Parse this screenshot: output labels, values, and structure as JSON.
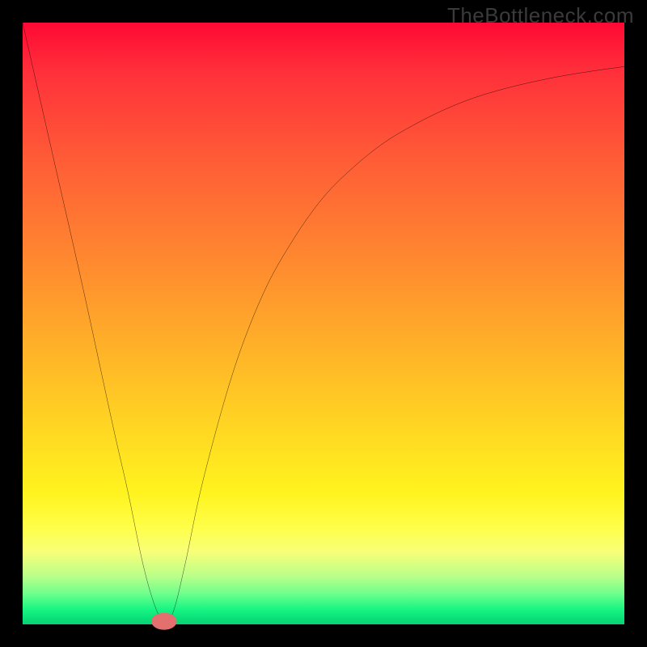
{
  "watermark": "TheBottleneck.com",
  "chart_data": {
    "type": "line",
    "title": "",
    "xlabel": "",
    "ylabel": "",
    "xlim": [
      0,
      100
    ],
    "ylim": [
      0,
      100
    ],
    "x": [
      0,
      5,
      10,
      15,
      17.5,
      20,
      22,
      23.5,
      25,
      27,
      30,
      35,
      40,
      45,
      50,
      55,
      60,
      65,
      70,
      75,
      80,
      85,
      90,
      95,
      100
    ],
    "y": [
      100,
      78,
      56,
      33,
      22,
      10,
      3,
      0.5,
      2,
      10,
      24,
      42,
      55,
      64,
      71,
      76,
      80,
      83,
      85.5,
      87.5,
      89,
      90.2,
      91.2,
      92,
      92.7
    ],
    "series": [
      {
        "name": "curve",
        "color": "#000000"
      }
    ],
    "marker": {
      "x": 23.5,
      "y": 0.5,
      "shape": "capsule",
      "color": "#e36f6f"
    },
    "background_gradient": {
      "direction": "vertical",
      "stops": [
        {
          "pos": 0,
          "color": "#ff0934"
        },
        {
          "pos": 80,
          "color": "#ffff4a"
        },
        {
          "pos": 100,
          "color": "#07d374"
        }
      ]
    }
  }
}
